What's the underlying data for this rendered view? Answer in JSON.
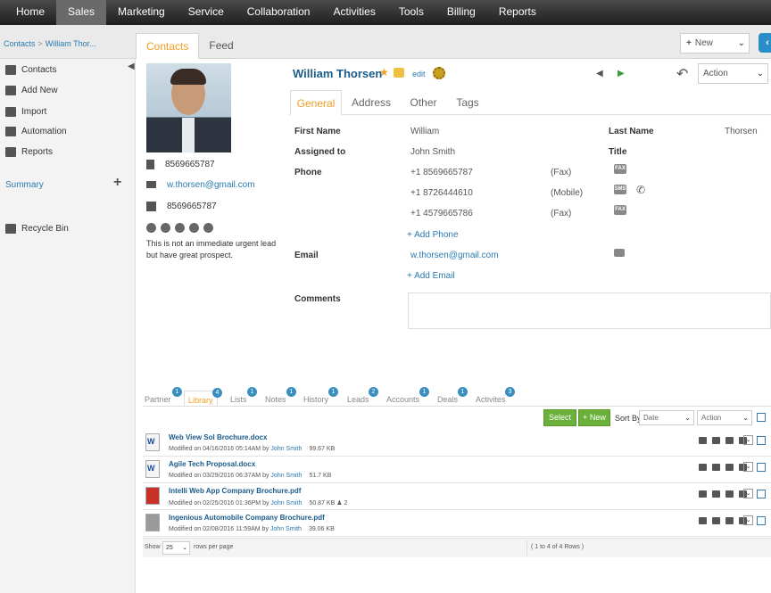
{
  "nav": [
    "Home",
    "Sales",
    "Marketing",
    "Service",
    "Collaboration",
    "Activities",
    "Tools",
    "Billing",
    "Reports"
  ],
  "breadcrumb": {
    "root": "Contacts",
    "sep": ">",
    "current": "William Thor..."
  },
  "top_tabs": [
    "Contacts",
    "Feed"
  ],
  "new_button": "New",
  "sidebar": {
    "items": [
      "Contacts",
      "Add New",
      "Import",
      "Automation",
      "Reports"
    ],
    "summary": "Summary",
    "recycle": "Recycle Bin"
  },
  "contact": {
    "phone1": "8569665787",
    "email": "w.thorsen@gmail.com",
    "fax": "8569665787",
    "bio": "This is not an immediate urgent lead but have great prospect.",
    "name": "William Thorsen",
    "edit": "edit"
  },
  "action_label": "Action",
  "detail_tabs": [
    "General",
    "Address",
    "Other",
    "Tags"
  ],
  "fields": {
    "first_name_label": "First Name",
    "first_name": "William",
    "last_name_label": "Last Name",
    "last_name": "Thorsen",
    "assigned_label": "Assigned to",
    "assigned": "John Smith",
    "title_label": "Title",
    "phone_label": "Phone",
    "phones": [
      {
        "number": "+1 8569665787",
        "type": "(Fax)"
      },
      {
        "number": "+1 8726444610",
        "type": "(Mobile)"
      },
      {
        "number": "+1 4579665786",
        "type": "(Fax)"
      }
    ],
    "add_phone": "+ Add Phone",
    "email_label": "Email",
    "email": "w.thorsen@gmail.com",
    "add_email": "+ Add Email",
    "comments_label": "Comments"
  },
  "icon_labels": {
    "fax": "FAX",
    "sms": "SMS"
  },
  "lower_tabs": [
    {
      "label": "Partner",
      "badge": "1"
    },
    {
      "label": "Library",
      "badge": "4"
    },
    {
      "label": "Lists",
      "badge": "1"
    },
    {
      "label": "Notes",
      "badge": "1"
    },
    {
      "label": "History",
      "badge": "1"
    },
    {
      "label": "Leads",
      "badge": "2"
    },
    {
      "label": "Accounts",
      "badge": "1"
    },
    {
      "label": "Deals",
      "badge": "1"
    },
    {
      "label": "Activites",
      "badge": "3"
    }
  ],
  "library_toolbar": {
    "select": "Select",
    "new": "+ New",
    "sort_by": "Sort By",
    "sort_value": "Date",
    "action": "Action"
  },
  "files": [
    {
      "name": "Web View Sol Brochure.docx",
      "modified": "Modified on 04/16/2016 05:14AM by",
      "by": "John Smith",
      "size": "99.67 KB",
      "extra": ""
    },
    {
      "name": "Agile Tech Proposal.docx",
      "modified": "Modified on 03/29/2016 06:37AM by",
      "by": "John Smith",
      "size": "51.7 KB",
      "extra": ""
    },
    {
      "name": "Intelli Web App Company Brochure.pdf",
      "modified": "Modified on 02/25/2016 01:36PM by",
      "by": "John Smith",
      "size": "50.87 KB",
      "extra": "2"
    },
    {
      "name": "Ingenious Automobile Company Brochure.pdf",
      "modified": "Modified on 02/08/2016 11:59AM by",
      "by": "John Smith",
      "size": "39.06 KB",
      "extra": ""
    }
  ],
  "pager": {
    "show": "Show",
    "per_page": "25",
    "rows_label": "rows per page",
    "range": "( 1 to 4 of 4 Rows )"
  }
}
